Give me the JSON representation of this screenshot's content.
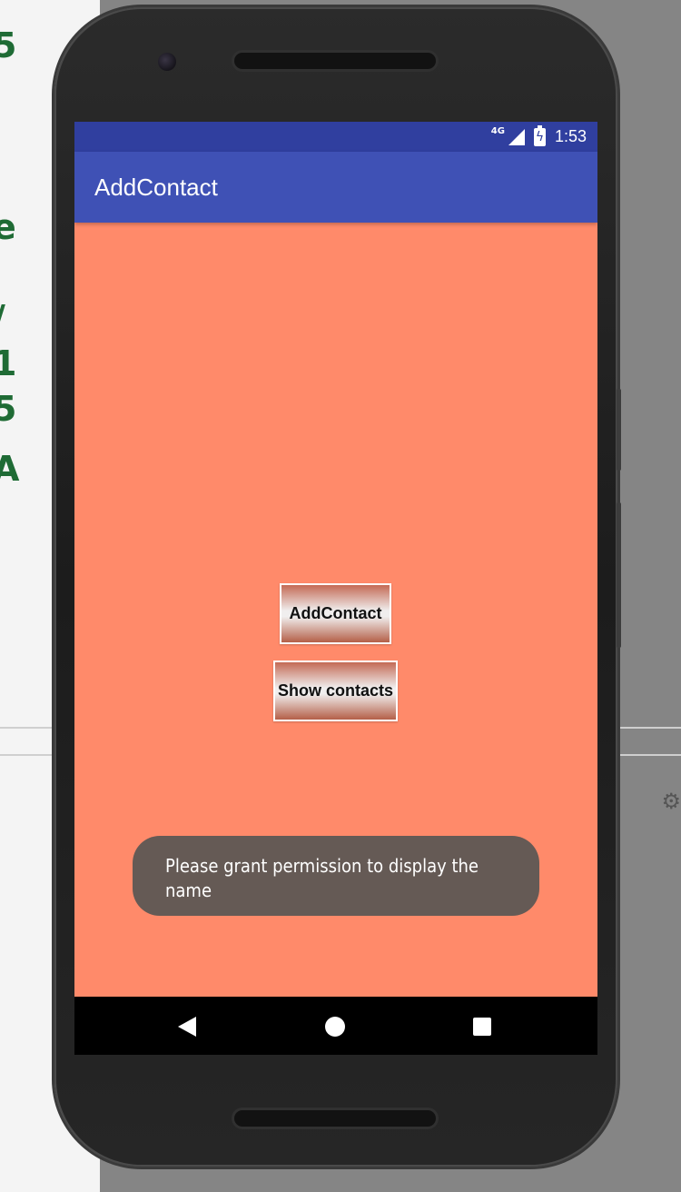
{
  "status_bar": {
    "network_label": "4G",
    "time": "1:53",
    "color": "#303f9f"
  },
  "app_bar": {
    "title": "AddContact",
    "color": "#3f51b5"
  },
  "screen": {
    "background_color": "#ff8a6a"
  },
  "buttons": {
    "add_contact": "AddContact",
    "show_contacts": "Show contacts"
  },
  "toast": {
    "message": "Please grant permission to display the name"
  },
  "navigation": {
    "back_icon": "triangle-back-icon",
    "home_icon": "circle-home-icon",
    "recents_icon": "square-recents-icon"
  }
}
